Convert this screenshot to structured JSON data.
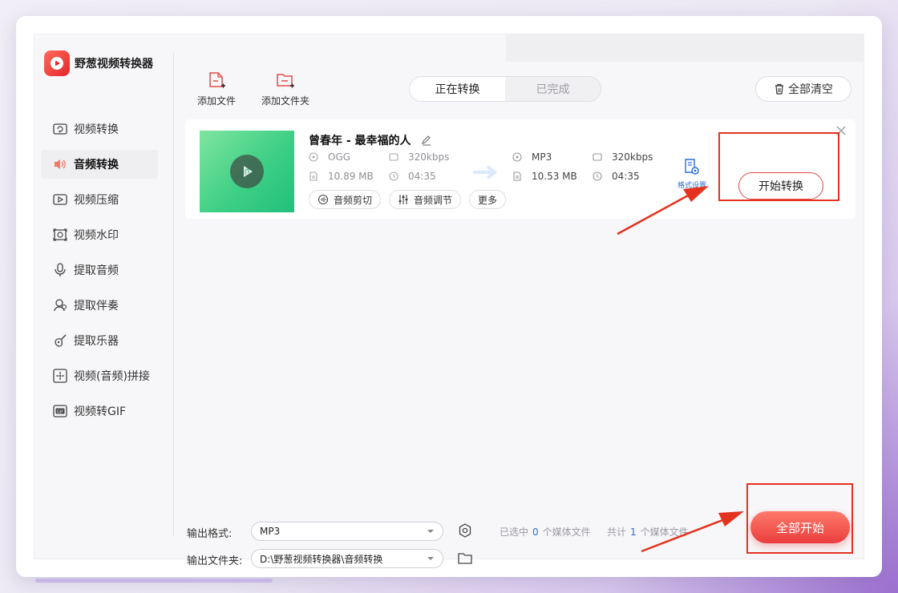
{
  "app": {
    "title": "野葱视频转换器"
  },
  "sidebar": {
    "items": [
      {
        "label": "视频转换",
        "icon": "video-convert-icon"
      },
      {
        "label": "音频转换",
        "icon": "audio-convert-icon",
        "active": true
      },
      {
        "label": "视频压缩",
        "icon": "video-compress-icon"
      },
      {
        "label": "视频水印",
        "icon": "video-watermark-icon"
      },
      {
        "label": "提取音频",
        "icon": "extract-audio-icon"
      },
      {
        "label": "提取伴奏",
        "icon": "extract-accompaniment-icon"
      },
      {
        "label": "提取乐器",
        "icon": "extract-instrument-icon"
      },
      {
        "label": "视频(音频)拼接",
        "icon": "merge-icon"
      },
      {
        "label": "视频转GIF",
        "icon": "gif-icon"
      }
    ]
  },
  "toolbar": {
    "add_file": "添加文件",
    "add_folder": "添加文件夹",
    "tab_converting": "正在转换",
    "tab_done": "已完成",
    "clear_all": "全部清空"
  },
  "file": {
    "name": "曾春年 - 最幸福的人",
    "source": {
      "format": "OGG",
      "bitrate": "320kbps",
      "size": "10.89 MB",
      "duration": "04:35"
    },
    "target": {
      "format": "MP3",
      "bitrate": "320kbps",
      "size": "10.53 MB",
      "duration": "04:35"
    },
    "actions": {
      "cut": "音频剪切",
      "adjust": "音频调节",
      "more": "更多"
    },
    "format_settings": "格式设置",
    "start": "开始转换"
  },
  "bottom": {
    "output_format_label": "输出格式:",
    "output_format_value": "MP3",
    "output_folder_label": "输出文件夹:",
    "output_folder_value": "D:\\野葱视频转换器\\音频转换",
    "selected_prefix": "已选中",
    "selected_count": "0",
    "selected_suffix": "个媒体文件",
    "total_prefix": "共计",
    "total_count": "1",
    "total_suffix": "个媒体文件",
    "start_all": "全部开始"
  },
  "colors": {
    "accent_red": "#ea3d3d",
    "annotation_red": "#e4321e",
    "link_blue": "#2a6fd6",
    "thumb_green": "#3ecf85"
  }
}
